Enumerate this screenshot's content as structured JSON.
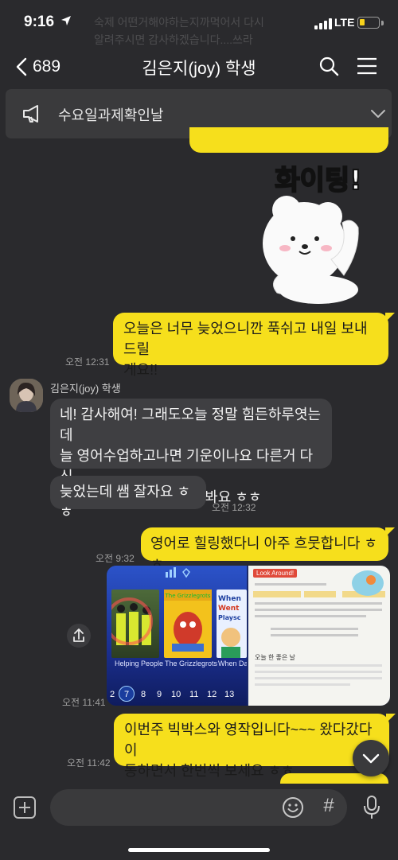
{
  "status_bar": {
    "time": "9:16",
    "network": "LTE",
    "ghost_line_1": "숙제 어떤거해야하는지까먹어서 다시",
    "ghost_line_2": "알려주시면 감사하겠습니다....쓰라",
    "battery_color": "#f7d21b"
  },
  "header": {
    "back_count": "689",
    "title": "김은지(joy) 학생"
  },
  "notice": {
    "text": "수요일과제확인날"
  },
  "sticker": {
    "caption": "화이팅!"
  },
  "messages": {
    "m1": {
      "line1": "오늘은 너무 늦었으니깐 푹쉬고 내일 보내드릴",
      "line2": "게요!!",
      "time": "오전 12:31"
    },
    "sender": "김은지(joy) 학생",
    "m2": {
      "line1": "네! 감사해여! 그래도오늘 정말 힘든하루엿는데",
      "line2": "늘 영어수업하고나면 기운이나요 다른거 다 신",
      "line3": "경안쓰고집중해서그런가봐요 ㅎㅎ"
    },
    "m3": {
      "text": "늦었는데 쌤 잘자요 ㅎㅎ",
      "time": "오전 12:32"
    },
    "m4": {
      "text": "영어로 힐링했다니 아주 흐뭇합니다 ㅎㅎ",
      "time": "오전 9:32"
    },
    "photo_time": "오전 11:41",
    "m5": {
      "line1": "이번주 빅박스와 영작입니다~~~ 왔다갔다 이",
      "line2": "동하면서 한번씩 보세요 ㅎㅎ",
      "time": "오전 11:42"
    }
  },
  "photo": {
    "books": [
      "Helping People",
      "The Grizzlegrots",
      "When Dad Went to Playsc"
    ],
    "levels": [
      "2",
      "7",
      "8",
      "9",
      "10",
      "11",
      "12",
      "13"
    ],
    "selected_level": "7",
    "doc_title": "Look Around!",
    "doc_caption": "오늘 한 좋은 날"
  },
  "input": {
    "placeholder": "",
    "hash": "#"
  },
  "colors": {
    "my_bubble": "#f6df1c",
    "their_bubble": "#3f3f42",
    "background": "#2a2a2d"
  }
}
